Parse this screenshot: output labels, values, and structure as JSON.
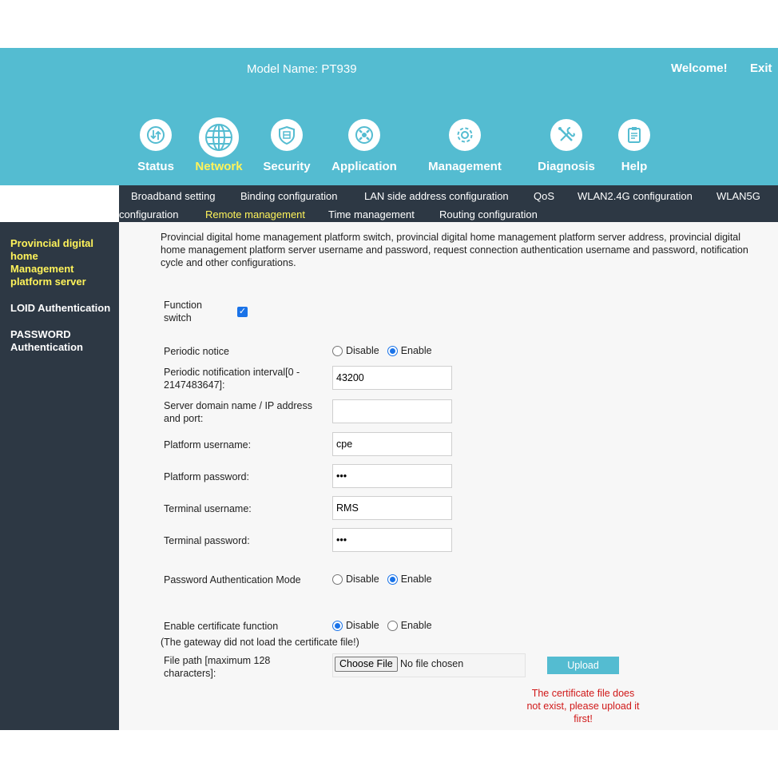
{
  "header": {
    "model_name": "Model Name: PT939",
    "welcome": "Welcome!",
    "exit": "Exit"
  },
  "nav": [
    {
      "label": "Status",
      "icon": "status-icon"
    },
    {
      "label": "Network",
      "icon": "globe-icon",
      "active": true
    },
    {
      "label": "Security",
      "icon": "shield-icon"
    },
    {
      "label": "Application",
      "icon": "application-icon"
    },
    {
      "label": "Management",
      "icon": "gear-icon"
    },
    {
      "label": "Diagnosis",
      "icon": "tools-icon"
    },
    {
      "label": "Help",
      "icon": "clipboard-icon"
    }
  ],
  "subnav": [
    {
      "label": "Broadband setting"
    },
    {
      "label": "Binding configuration"
    },
    {
      "label": "LAN side address configuration"
    },
    {
      "label": "QoS"
    },
    {
      "label": "WLAN2.4G configuration"
    },
    {
      "label": "WLAN5G"
    },
    {
      "label": "configuration"
    },
    {
      "label": "Remote management",
      "active": true
    },
    {
      "label": "Time management"
    },
    {
      "label": "Routing configuration"
    }
  ],
  "sidebar": [
    {
      "lines": [
        "Provincial digital",
        "home",
        "Management",
        "platform server"
      ],
      "active": true
    },
    {
      "lines": [
        "LOID Authentication"
      ]
    },
    {
      "lines": [
        "PASSWORD",
        "Authentication"
      ]
    }
  ],
  "main": {
    "description": "Provincial digital home management platform switch, provincial digital home management platform server address, provincial digital home management platform server username and password, request connection authentication username and password, notification cycle and other configurations.",
    "function_switch_label": "Function switch",
    "function_switch_checked": true,
    "periodic_notice": {
      "label": "Periodic notice",
      "disable": "Disable",
      "enable": "Enable",
      "selected": "Enable"
    },
    "interval": {
      "label": "Periodic notification interval[0 - 2147483647]:",
      "value": "43200"
    },
    "server": {
      "label": "Server domain name / IP address and port:",
      "value": ""
    },
    "platform_username": {
      "label": "Platform username:",
      "value": "cpe"
    },
    "platform_password": {
      "label": "Platform password:",
      "value": "•••"
    },
    "terminal_username": {
      "label": "Terminal username:",
      "value": "RMS"
    },
    "terminal_password": {
      "label": "Terminal password:",
      "value": "•••"
    },
    "password_auth_mode": {
      "label": "Password Authentication Mode",
      "disable": "Disable",
      "enable": "Enable",
      "selected": "Enable"
    },
    "certificate": {
      "label": "Enable certificate function",
      "disable": "Disable",
      "enable": "Enable",
      "selected": "Disable"
    },
    "cert_note": "(The gateway did not load the certificate file!)",
    "file_path": {
      "label": "File path [maximum 128 characters]:",
      "choose": "Choose File",
      "no_file": "No file chosen"
    },
    "upload": "Upload",
    "error": "The certificate file does not exist, please upload it first!"
  },
  "colors": {
    "header": "#54bcd1",
    "dark": "#2d3844",
    "active": "#fff35a",
    "error": "#d01818"
  }
}
